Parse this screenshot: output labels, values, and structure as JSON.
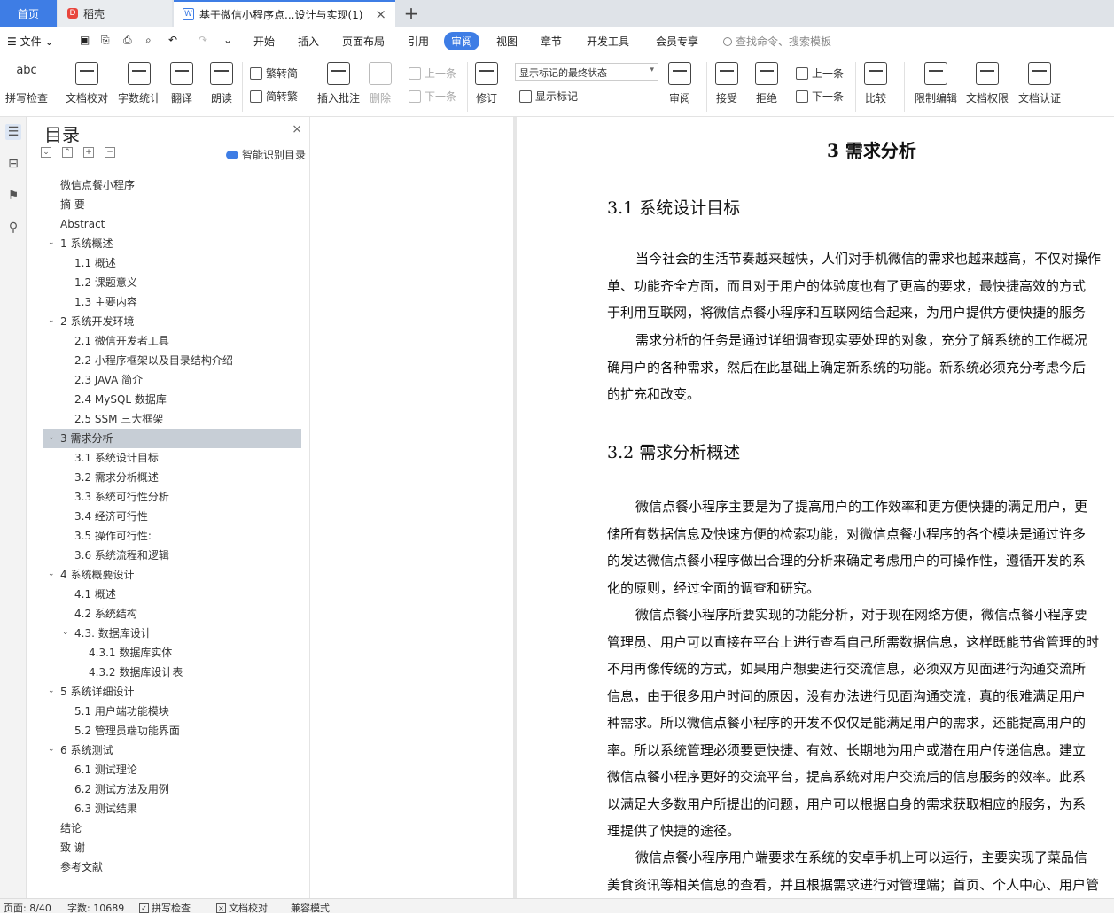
{
  "tabs": {
    "home": "首页",
    "daoke": "稻壳",
    "daoke_icon": "D",
    "doc": "基于微信小程序点...设计与实现(1)",
    "doc_icon": "W",
    "close": "×",
    "add": "+"
  },
  "menu": {
    "file": "文件",
    "items": [
      "开始",
      "插入",
      "页面布局",
      "引用",
      "审阅",
      "视图",
      "章节",
      "开发工具",
      "会员专享"
    ],
    "active": "审阅",
    "search_placeholder": "查找命令、搜索模板"
  },
  "ribbon": {
    "spell": "拼写检查",
    "proofread": "文档校对",
    "wordcount": "字数统计",
    "translate": "翻译",
    "read": "朗读",
    "t2s": "繁转简",
    "s2t": "简转繁",
    "insert_comment": "插入批注",
    "delete": "删除",
    "prev_comment": "上一条",
    "next_comment": "下一条",
    "track": "修订",
    "display_state": "显示标记的最终状态",
    "show_markup": "显示标记",
    "review": "审阅",
    "accept": "接受",
    "reject": "拒绝",
    "prev_change": "上一条",
    "next_change": "下一条",
    "compare": "比较",
    "restrict": "限制编辑",
    "permission": "文档权限",
    "certify": "文档认证",
    "abc": "abc"
  },
  "toc": {
    "title": "目录",
    "smart": "智能识别目录",
    "close": "×",
    "items": [
      {
        "text": "微信点餐小程序",
        "lvl": 0,
        "arrow": false
      },
      {
        "text": "摘  要",
        "lvl": 0,
        "arrow": false
      },
      {
        "text": "Abstract",
        "lvl": 0,
        "arrow": false
      },
      {
        "text": "1  系统概述",
        "lvl": 0,
        "arrow": true
      },
      {
        "text": "1.1  概述",
        "lvl": 1,
        "arrow": false
      },
      {
        "text": "1.2 课题意义",
        "lvl": 1,
        "arrow": false
      },
      {
        "text": "1.3  主要内容",
        "lvl": 1,
        "arrow": false
      },
      {
        "text": "2  系统开发环境",
        "lvl": 0,
        "arrow": true
      },
      {
        "text": "2.1 微信开发者工具",
        "lvl": 1,
        "arrow": false
      },
      {
        "text": "2.2 小程序框架以及目录结构介绍",
        "lvl": 1,
        "arrow": false
      },
      {
        "text": "2.3 JAVA 简介",
        "lvl": 1,
        "arrow": false
      },
      {
        "text": "2.4 MySQL 数据库",
        "lvl": 1,
        "arrow": false
      },
      {
        "text": "2.5 SSM 三大框架",
        "lvl": 1,
        "arrow": false
      },
      {
        "text": "3  需求分析",
        "lvl": 0,
        "arrow": true,
        "sel": true
      },
      {
        "text": "3.1  系统设计目标",
        "lvl": 1,
        "arrow": false
      },
      {
        "text": "3.2 需求分析概述",
        "lvl": 1,
        "arrow": false
      },
      {
        "text": "3.3  系统可行性分析",
        "lvl": 1,
        "arrow": false
      },
      {
        "text": "3.4 经济可行性",
        "lvl": 1,
        "arrow": false
      },
      {
        "text": "3.5 操作可行性:",
        "lvl": 1,
        "arrow": false
      },
      {
        "text": "3.6 系统流程和逻辑",
        "lvl": 1,
        "arrow": false
      },
      {
        "text": "4 系统概要设计",
        "lvl": 0,
        "arrow": true
      },
      {
        "text": "4.1  概述",
        "lvl": 1,
        "arrow": false
      },
      {
        "text": "4.2  系统结构",
        "lvl": 1,
        "arrow": false
      },
      {
        "text": "4.3.  数据库设计",
        "lvl": 1,
        "arrow": true
      },
      {
        "text": "4.3.1  数据库实体",
        "lvl": 2,
        "arrow": false
      },
      {
        "text": "4.3.2  数据库设计表",
        "lvl": 2,
        "arrow": false
      },
      {
        "text": "5 系统详细设计",
        "lvl": 0,
        "arrow": true
      },
      {
        "text": "5.1 用户端功能模块",
        "lvl": 1,
        "arrow": false
      },
      {
        "text": "5.2 管理员端功能界面",
        "lvl": 1,
        "arrow": false
      },
      {
        "text": "6  系统测试",
        "lvl": 0,
        "arrow": true
      },
      {
        "text": "6.1  测试理论",
        "lvl": 1,
        "arrow": false
      },
      {
        "text": "6.2  测试方法及用例",
        "lvl": 1,
        "arrow": false
      },
      {
        "text": "6.3 测试结果",
        "lvl": 1,
        "arrow": false
      },
      {
        "text": "结论",
        "lvl": 0,
        "arrow": false
      },
      {
        "text": "致  谢",
        "lvl": 0,
        "arrow": false
      },
      {
        "text": "参考文献",
        "lvl": 0,
        "arrow": false
      }
    ]
  },
  "doc": {
    "chapter": "3  需求分析",
    "sec1": "3.1  系统设计目标",
    "p1": [
      "当今社会的生活节奏越来越快，人们对手机微信的需求也越来越高，不仅对操作",
      "单、功能齐全方面，而且对于用户的体验度也有了更高的要求，最快捷高效的方式",
      "于利用互联网，将微信点餐小程序和互联网结合起来，为用户提供方便快捷的服务"
    ],
    "p2": [
      "需求分析的任务是通过详细调查现实要处理的对象，充分了解系统的工作概况",
      "确用户的各种需求，然后在此基础上确定新系统的功能。新系统必须充分考虑今后",
      "的扩充和改变。"
    ],
    "sec2": "3.2 需求分析概述",
    "p3": [
      "微信点餐小程序主要是为了提高用户的工作效率和更方便快捷的满足用户，更",
      "储所有数据信息及快速方便的检索功能，对微信点餐小程序的各个模块是通过许多",
      "的发达微信点餐小程序做出合理的分析来确定考虑用户的可操作性，遵循开发的系",
      "化的原则，经过全面的调查和研究。"
    ],
    "p4": [
      "微信点餐小程序所要实现的功能分析，对于现在网络方便，微信点餐小程序要",
      "管理员、用户可以直接在平台上进行查看自己所需数据信息，这样既能节省管理的时",
      "不用再像传统的方式，如果用户想要进行交流信息，必须双方见面进行沟通交流所",
      "信息，由于很多用户时间的原因，没有办法进行见面沟通交流，真的很难满足用户",
      "种需求。所以微信点餐小程序的开发不仅仅是能满足用户的需求，还能提高用户的",
      "率。所以系统管理必须要更快捷、有效、长期地为用户或潜在用户传递信息。建立",
      "微信点餐小程序更好的交流平台，提高系统对用户交流后的信息服务的效率。此系",
      "以满足大多数用户所提出的问题，用户可以根据自身的需求获取相应的服务，为系",
      "理提供了快捷的途径。"
    ],
    "p5": [
      "微信点餐小程序用户端要求在系统的安卓手机上可以运行，主要实现了菜品信",
      "美食资讯等相关信息的查看，并且根据需求进行对管理端；首页、个人中心、用户管"
    ]
  },
  "status": {
    "page": "页面: 8/40",
    "words": "字数: 10689",
    "spell": "拼写检查",
    "proof": "文档校对",
    "compat": "兼容模式",
    "check": "✓",
    "cross": "×"
  }
}
